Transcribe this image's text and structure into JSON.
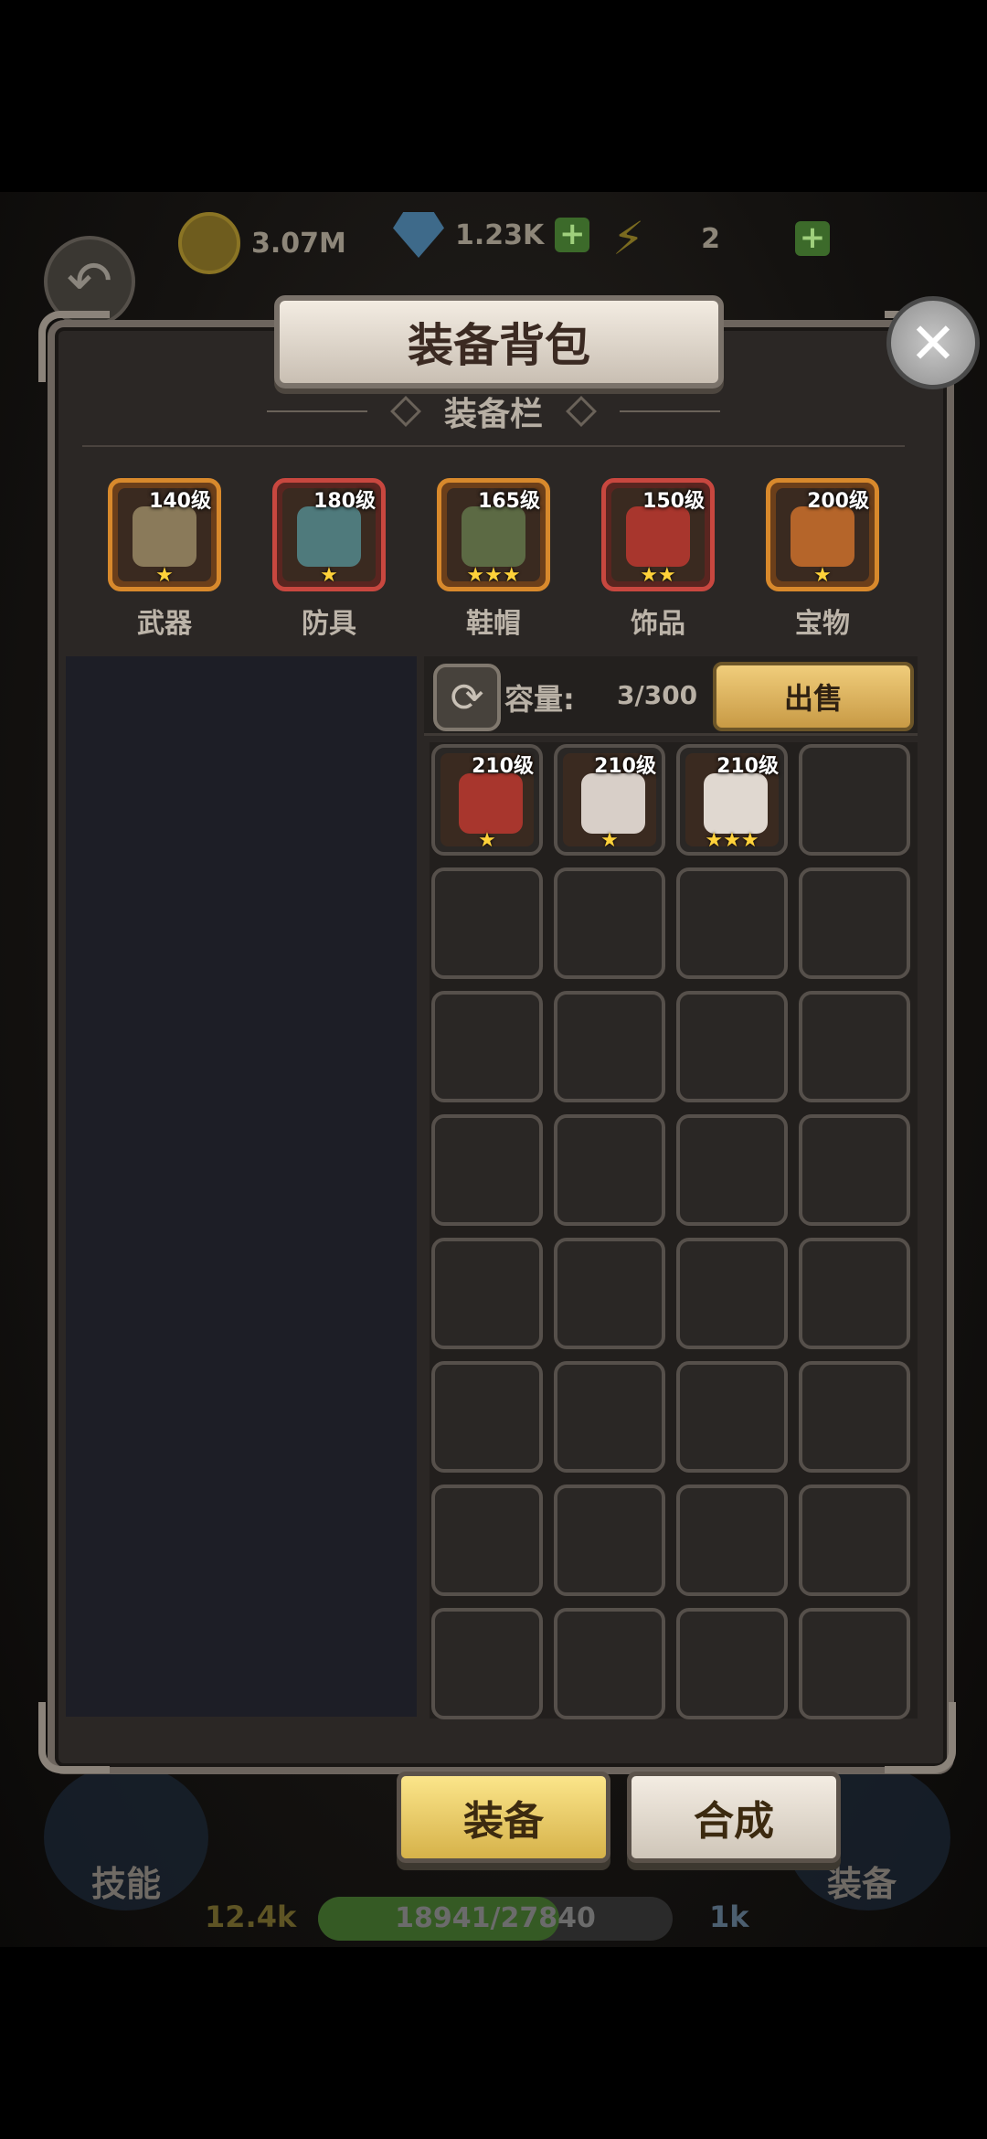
{
  "topbar": {
    "gold": "3.07M",
    "gems": "1.23K",
    "energy": "2",
    "plus": "+"
  },
  "dialog": {
    "title": "装备背包",
    "section": "装备栏",
    "close": "✕"
  },
  "equip_slots": [
    {
      "label": "武器",
      "level": "140级",
      "stars": "★",
      "rarity": "orange"
    },
    {
      "label": "防具",
      "level": "180级",
      "stars": "★",
      "rarity": "red"
    },
    {
      "label": "鞋帽",
      "level": "165级",
      "stars": "★★★",
      "rarity": "orange"
    },
    {
      "label": "饰品",
      "level": "150级",
      "stars": "★★",
      "rarity": "red"
    },
    {
      "label": "宝物",
      "level": "200级",
      "stars": "★",
      "rarity": "orange"
    }
  ],
  "inventory": {
    "capacity_label": "容量:",
    "capacity_value": "3/300",
    "sell_label": "出售",
    "refresh_icon": "⟳",
    "items": [
      {
        "level": "210级",
        "stars": "★",
        "rarity": "orange"
      },
      {
        "level": "210级",
        "stars": "★",
        "rarity": "gray"
      },
      {
        "level": "210级",
        "stars": "★★★",
        "rarity": "purple"
      }
    ]
  },
  "bottom": {
    "equip_tab": "装备",
    "craft_tab": "合成",
    "skill_label": "技能",
    "equip_label": "装备",
    "power": "12.4k",
    "exp": "18941/27840",
    "exp_fraction": 0.68,
    "right_stat": "1k"
  },
  "back_icon": "↶"
}
